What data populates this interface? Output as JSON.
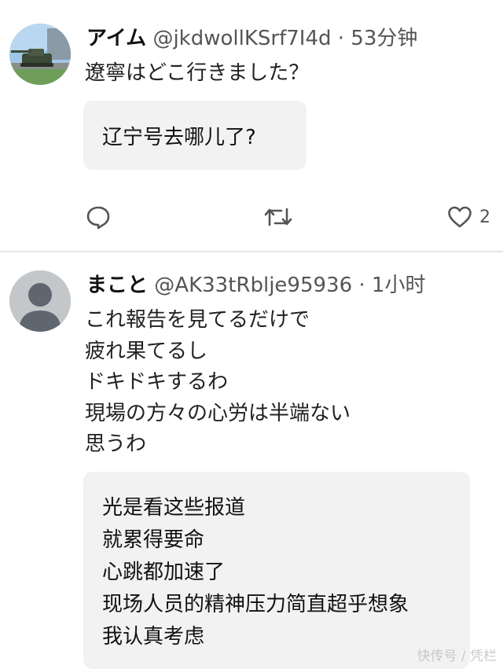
{
  "posts": [
    {
      "author": "アイム",
      "handle": "@jkdwollKSrf7I4d · 53分钟",
      "body": [
        "遼寧はどこ行きました？"
      ],
      "translation": [
        "辽宁号去哪儿了?"
      ],
      "actions": {
        "like_count": "2"
      }
    },
    {
      "author": "まこと",
      "handle": "@AK33tRblje95936 · 1小时",
      "body": [
        "これ報告を見てるだけで",
        "疲れ果てるし",
        "ドキドキするわ",
        "現場の方々の心労は半端ない",
        "思うわ"
      ],
      "translation": [
        "光是看这些报道",
        "就累得要命",
        "心跳都加速了",
        "现场人员的精神压力简直超乎想象",
        "我认真考虑"
      ]
    }
  ],
  "icons": {
    "reply": "reply-icon",
    "retweet": "retweet-icon",
    "like": "heart-icon",
    "avatar_default": "default-avatar-icon"
  },
  "colors": {
    "translation_bg": "#f2f2f2",
    "icon": "#555555",
    "divider": "#e6e6e6"
  },
  "watermark": "快传号 / 凭栏"
}
